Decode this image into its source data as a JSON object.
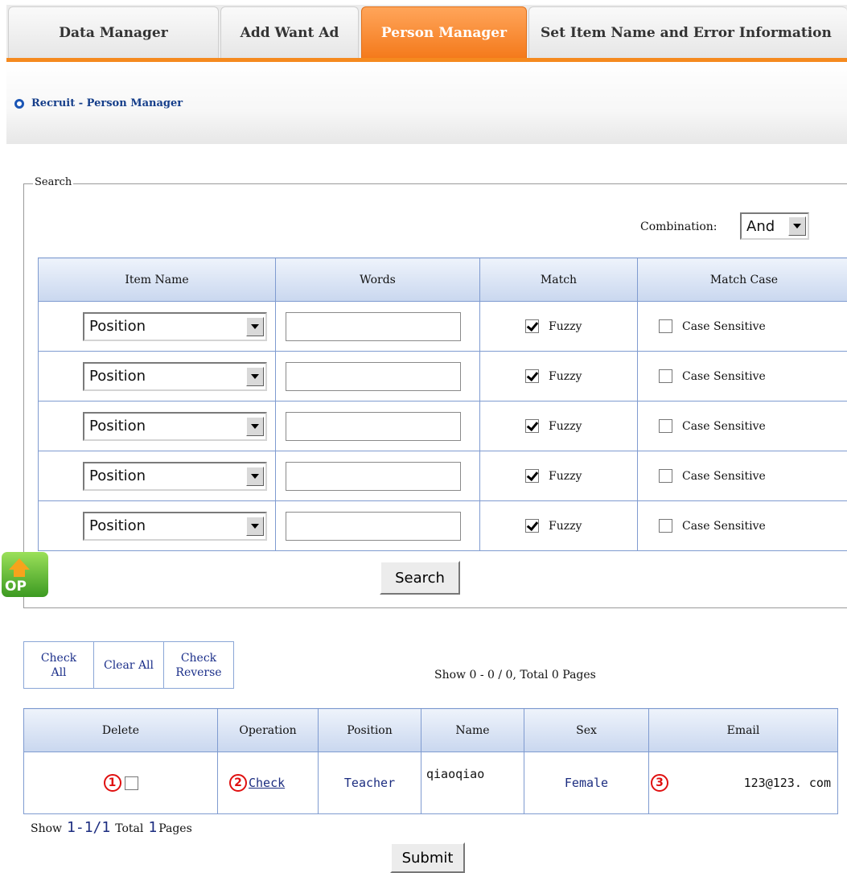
{
  "tabs": [
    {
      "label": "Data Manager"
    },
    {
      "label": "Add Want Ad"
    },
    {
      "label": "Person Manager",
      "active": true
    },
    {
      "label": "Set Item Name and Error Information"
    }
  ],
  "breadcrumb": "Recruit - Person Manager",
  "search": {
    "legend": "Search",
    "combination_label": "Combination:",
    "combination_value": "And",
    "headers": [
      "Item Name",
      "Words",
      "Match",
      "Match Case"
    ],
    "rows": [
      {
        "item": "Position",
        "words": "",
        "match_label": "Fuzzy",
        "match_checked": true,
        "case_label": "Case Sensitive",
        "case_checked": false
      },
      {
        "item": "Position",
        "words": "",
        "match_label": "Fuzzy",
        "match_checked": true,
        "case_label": "Case Sensitive",
        "case_checked": false
      },
      {
        "item": "Position",
        "words": "",
        "match_label": "Fuzzy",
        "match_checked": true,
        "case_label": "Case Sensitive",
        "case_checked": false
      },
      {
        "item": "Position",
        "words": "",
        "match_label": "Fuzzy",
        "match_checked": true,
        "case_label": "Case Sensitive",
        "case_checked": false
      },
      {
        "item": "Position",
        "words": "",
        "match_label": "Fuzzy",
        "match_checked": true,
        "case_label": "Case Sensitive",
        "case_checked": false
      }
    ],
    "button": "Search"
  },
  "top_button": {
    "label": "OP"
  },
  "actions": {
    "check_all": "Check All",
    "clear_all": "Clear All",
    "check_reverse": "Check Reverse"
  },
  "page_info": "Show 0 - 0 / 0, Total 0 Pages",
  "results": {
    "headers": [
      "Delete",
      "Operation",
      "Position",
      "Name",
      "Sex",
      "Email"
    ],
    "rows": [
      {
        "marker_delete": "1",
        "operation": "Check",
        "marker_operation": "2",
        "position": "Teacher",
        "name": "qiaoqiao",
        "sex": "Female",
        "marker_sex": "3",
        "email": "123@123. com"
      }
    ]
  },
  "footer": {
    "show": "Show",
    "range": "1-1/1",
    "total": "Total",
    "pages_num": "1",
    "pages": "Pages",
    "submit": "Submit"
  }
}
